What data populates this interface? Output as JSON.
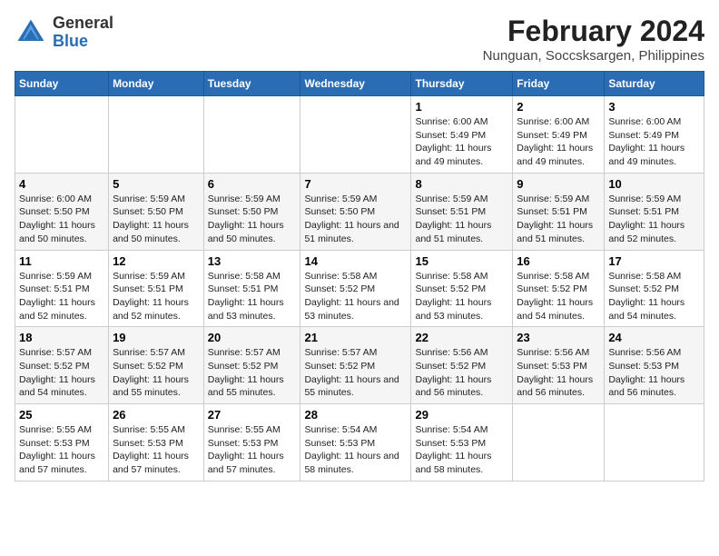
{
  "header": {
    "logo_general": "General",
    "logo_blue": "Blue",
    "title": "February 2024",
    "subtitle": "Nunguan, Soccsksargen, Philippines"
  },
  "days_of_week": [
    "Sunday",
    "Monday",
    "Tuesday",
    "Wednesday",
    "Thursday",
    "Friday",
    "Saturday"
  ],
  "weeks": [
    [
      {
        "day": "",
        "info": ""
      },
      {
        "day": "",
        "info": ""
      },
      {
        "day": "",
        "info": ""
      },
      {
        "day": "",
        "info": ""
      },
      {
        "day": "1",
        "info": "Sunrise: 6:00 AM\nSunset: 5:49 PM\nDaylight: 11 hours\nand 49 minutes."
      },
      {
        "day": "2",
        "info": "Sunrise: 6:00 AM\nSunset: 5:49 PM\nDaylight: 11 hours\nand 49 minutes."
      },
      {
        "day": "3",
        "info": "Sunrise: 6:00 AM\nSunset: 5:49 PM\nDaylight: 11 hours\nand 49 minutes."
      }
    ],
    [
      {
        "day": "4",
        "info": "Sunrise: 6:00 AM\nSunset: 5:50 PM\nDaylight: 11 hours\nand 50 minutes."
      },
      {
        "day": "5",
        "info": "Sunrise: 5:59 AM\nSunset: 5:50 PM\nDaylight: 11 hours\nand 50 minutes."
      },
      {
        "day": "6",
        "info": "Sunrise: 5:59 AM\nSunset: 5:50 PM\nDaylight: 11 hours\nand 50 minutes."
      },
      {
        "day": "7",
        "info": "Sunrise: 5:59 AM\nSunset: 5:50 PM\nDaylight: 11 hours\nand 51 minutes."
      },
      {
        "day": "8",
        "info": "Sunrise: 5:59 AM\nSunset: 5:51 PM\nDaylight: 11 hours\nand 51 minutes."
      },
      {
        "day": "9",
        "info": "Sunrise: 5:59 AM\nSunset: 5:51 PM\nDaylight: 11 hours\nand 51 minutes."
      },
      {
        "day": "10",
        "info": "Sunrise: 5:59 AM\nSunset: 5:51 PM\nDaylight: 11 hours\nand 52 minutes."
      }
    ],
    [
      {
        "day": "11",
        "info": "Sunrise: 5:59 AM\nSunset: 5:51 PM\nDaylight: 11 hours\nand 52 minutes."
      },
      {
        "day": "12",
        "info": "Sunrise: 5:59 AM\nSunset: 5:51 PM\nDaylight: 11 hours\nand 52 minutes."
      },
      {
        "day": "13",
        "info": "Sunrise: 5:58 AM\nSunset: 5:51 PM\nDaylight: 11 hours\nand 53 minutes."
      },
      {
        "day": "14",
        "info": "Sunrise: 5:58 AM\nSunset: 5:52 PM\nDaylight: 11 hours\nand 53 minutes."
      },
      {
        "day": "15",
        "info": "Sunrise: 5:58 AM\nSunset: 5:52 PM\nDaylight: 11 hours\nand 53 minutes."
      },
      {
        "day": "16",
        "info": "Sunrise: 5:58 AM\nSunset: 5:52 PM\nDaylight: 11 hours\nand 54 minutes."
      },
      {
        "day": "17",
        "info": "Sunrise: 5:58 AM\nSunset: 5:52 PM\nDaylight: 11 hours\nand 54 minutes."
      }
    ],
    [
      {
        "day": "18",
        "info": "Sunrise: 5:57 AM\nSunset: 5:52 PM\nDaylight: 11 hours\nand 54 minutes."
      },
      {
        "day": "19",
        "info": "Sunrise: 5:57 AM\nSunset: 5:52 PM\nDaylight: 11 hours\nand 55 minutes."
      },
      {
        "day": "20",
        "info": "Sunrise: 5:57 AM\nSunset: 5:52 PM\nDaylight: 11 hours\nand 55 minutes."
      },
      {
        "day": "21",
        "info": "Sunrise: 5:57 AM\nSunset: 5:52 PM\nDaylight: 11 hours\nand 55 minutes."
      },
      {
        "day": "22",
        "info": "Sunrise: 5:56 AM\nSunset: 5:52 PM\nDaylight: 11 hours\nand 56 minutes."
      },
      {
        "day": "23",
        "info": "Sunrise: 5:56 AM\nSunset: 5:53 PM\nDaylight: 11 hours\nand 56 minutes."
      },
      {
        "day": "24",
        "info": "Sunrise: 5:56 AM\nSunset: 5:53 PM\nDaylight: 11 hours\nand 56 minutes."
      }
    ],
    [
      {
        "day": "25",
        "info": "Sunrise: 5:55 AM\nSunset: 5:53 PM\nDaylight: 11 hours\nand 57 minutes."
      },
      {
        "day": "26",
        "info": "Sunrise: 5:55 AM\nSunset: 5:53 PM\nDaylight: 11 hours\nand 57 minutes."
      },
      {
        "day": "27",
        "info": "Sunrise: 5:55 AM\nSunset: 5:53 PM\nDaylight: 11 hours\nand 57 minutes."
      },
      {
        "day": "28",
        "info": "Sunrise: 5:54 AM\nSunset: 5:53 PM\nDaylight: 11 hours\nand 58 minutes."
      },
      {
        "day": "29",
        "info": "Sunrise: 5:54 AM\nSunset: 5:53 PM\nDaylight: 11 hours\nand 58 minutes."
      },
      {
        "day": "",
        "info": ""
      },
      {
        "day": "",
        "info": ""
      }
    ]
  ]
}
